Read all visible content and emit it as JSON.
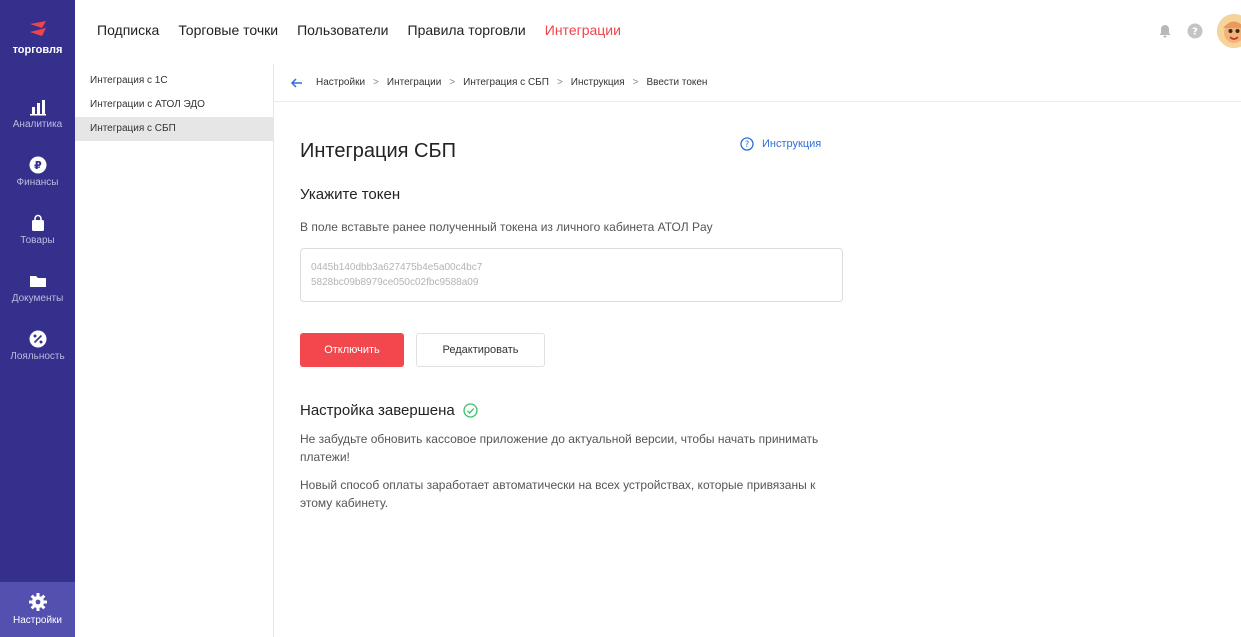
{
  "brand": {
    "name": "торговля",
    "accent_color": "#f0444b",
    "rail_color": "#35308c"
  },
  "rail": {
    "items": [
      {
        "label": "Аналитика",
        "icon": "bar-chart-icon"
      },
      {
        "label": "Финансы",
        "icon": "ruble-coin-icon"
      },
      {
        "label": "Товары",
        "icon": "shopping-bag-icon"
      },
      {
        "label": "Документы",
        "icon": "folder-icon"
      },
      {
        "label": "Лояльность",
        "icon": "percent-badge-icon"
      }
    ],
    "settings_label": "Настройки"
  },
  "topnav": {
    "tabs": [
      {
        "label": "Подписка"
      },
      {
        "label": "Торговые точки"
      },
      {
        "label": "Пользователи"
      },
      {
        "label": "Правила торговли"
      },
      {
        "label": "Интеграции",
        "active": true
      }
    ]
  },
  "subnav": {
    "items": [
      {
        "label": "Интеграция с 1С"
      },
      {
        "label": "Интеграции с АТОЛ ЭДО"
      },
      {
        "label": "Интеграция с СБП",
        "active": true
      }
    ]
  },
  "breadcrumb": {
    "items": [
      "Настройки",
      "Интеграции",
      "Интеграция с СБП",
      "Инструкция",
      "Ввести токен"
    ],
    "separator": ">"
  },
  "main": {
    "title": "Интеграция СБП",
    "instruction_link": "Инструкция",
    "section_title": "Укажите токен",
    "hint": "В поле вставьте ранее полученный токена из личного кабинета АТОЛ Pay",
    "token_line1": "0445b140dbb3a627475b4e5a00c4bc7",
    "token_line2": "5828bc09b8979ce050c02fbc9588a09",
    "disable_label": "Отключить",
    "edit_label": "Редактировать",
    "done_title": "Настройка завершена",
    "para1": "Не забудьте обновить кассовое приложение до актуальной версии, чтобы начать принимать платежи!",
    "para2": "Новый способ оплаты заработает автоматически на всех устройствах, которые привязаны к этому кабинету."
  }
}
